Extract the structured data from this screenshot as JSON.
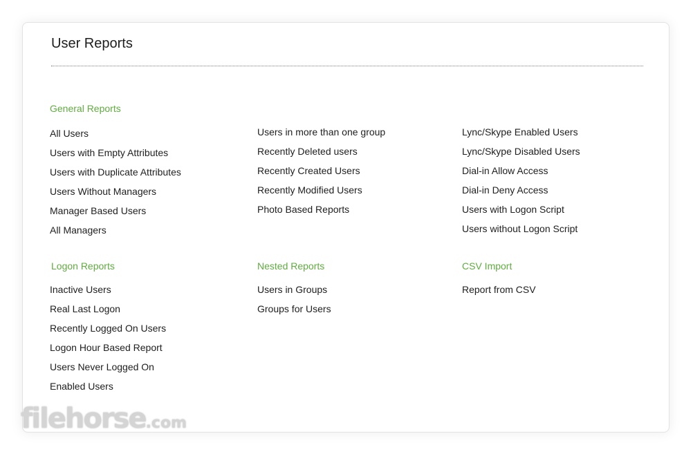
{
  "page_title": "User Reports",
  "sections": {
    "general": {
      "title": "General Reports",
      "col1": [
        "All Users",
        "Users with Empty Attributes",
        "Users with Duplicate Attributes",
        "Users Without Managers",
        "Manager Based Users",
        "All Managers"
      ],
      "col2": [
        "Users in more than one group",
        "Recently Deleted users",
        "Recently Created Users",
        "Recently Modified Users",
        "Photo Based Reports"
      ],
      "col3": [
        "Lync/Skype Enabled Users",
        "Lync/Skype Disabled Users",
        "Dial-in Allow Access",
        "Dial-in Deny Access",
        "Users with Logon Script",
        "Users without Logon Script"
      ]
    },
    "logon": {
      "title": "Logon Reports",
      "items": [
        "Inactive Users",
        "Real Last Logon",
        "Recently Logged On Users",
        "Logon Hour Based Report",
        "Users Never Logged On",
        "Enabled Users"
      ]
    },
    "nested": {
      "title": "Nested Reports",
      "items": [
        "Users in Groups",
        "Groups for Users"
      ]
    },
    "csv": {
      "title": "CSV Import",
      "items": [
        "Report from CSV"
      ]
    }
  },
  "watermark": {
    "brand": "filehorse",
    "suffix": ".com"
  },
  "colors": {
    "section_title": "#5fad3f",
    "link_text": "#202020"
  }
}
